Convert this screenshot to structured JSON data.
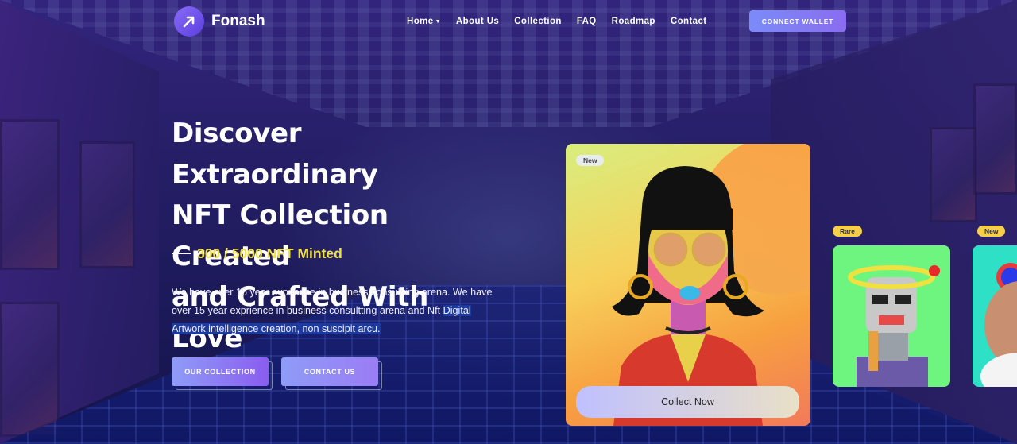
{
  "brand": {
    "name": "Fonash"
  },
  "nav": {
    "items": [
      {
        "label": "Home",
        "dropdown": true
      },
      {
        "label": "About Us"
      },
      {
        "label": "Collection"
      },
      {
        "label": "FAQ"
      },
      {
        "label": "Roadmap"
      },
      {
        "label": "Contact"
      }
    ],
    "wallet_label": "CONNECT WALLET"
  },
  "hero": {
    "title_lines": [
      "Discover Extraordinary",
      "NFT Collection Created",
      "and Crafted With Love"
    ],
    "minted": "300 / 5000 NFT Minted",
    "desc_plain": "We have over 15 year exprience in business consultting arena. We have over 15 year exprience in business consultting arena and Nft ",
    "desc_highlight": "Digital Artwork intelligence creation, non suscipit arcu.",
    "buttons": {
      "collection": "OUR COLLECTION",
      "contact": "CONTACT US"
    }
  },
  "cards": {
    "main": {
      "badge": "New",
      "cta": "Collect Now"
    },
    "second": {
      "badge": "Rare"
    },
    "third": {
      "badge": "New"
    }
  },
  "colors": {
    "accent": "#8a6cf0",
    "minted": "#f1e044",
    "highlight": "#1d3a9e"
  },
  "icons": {
    "logo": "arrow-up-right-icon",
    "home_caret": "caret-down-icon"
  }
}
